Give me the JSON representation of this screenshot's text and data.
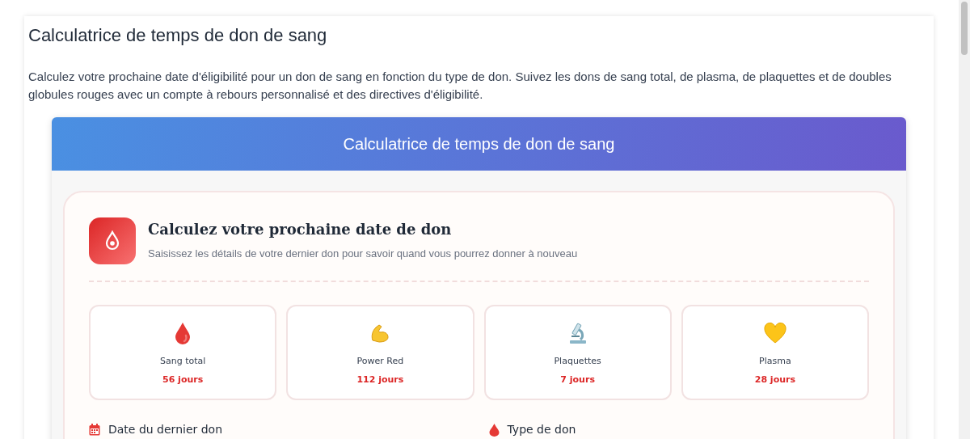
{
  "page": {
    "title": "Calculatrice de temps de don de sang",
    "intro": "Calculez votre prochaine date d'éligibilité pour un don de sang en fonction du type de don. Suivez les dons de sang total, de plasma, de plaquettes et de doubles globules rouges avec un compte à rebours personnalisé et des directives d'éligibilité."
  },
  "widget": {
    "header": "Calculatrice de temps de don de sang",
    "card": {
      "title": "Calculez votre prochaine date de don",
      "subtitle": "Saisissez les détails de votre dernier don pour savoir quand vous pourrez donner à nouveau"
    },
    "types": [
      {
        "kind": "blood",
        "name": "Sang total",
        "interval": "56 jours"
      },
      {
        "kind": "muscle",
        "name": "Power Red",
        "interval": "112 jours"
      },
      {
        "kind": "microscope",
        "name": "Plaquettes",
        "interval": "7 jours"
      },
      {
        "kind": "heart",
        "name": "Plasma",
        "interval": "28 jours"
      }
    ],
    "fields": [
      {
        "kind": "calendar",
        "label": "Date du dernier don"
      },
      {
        "kind": "drop",
        "label": "Type de don"
      }
    ]
  }
}
